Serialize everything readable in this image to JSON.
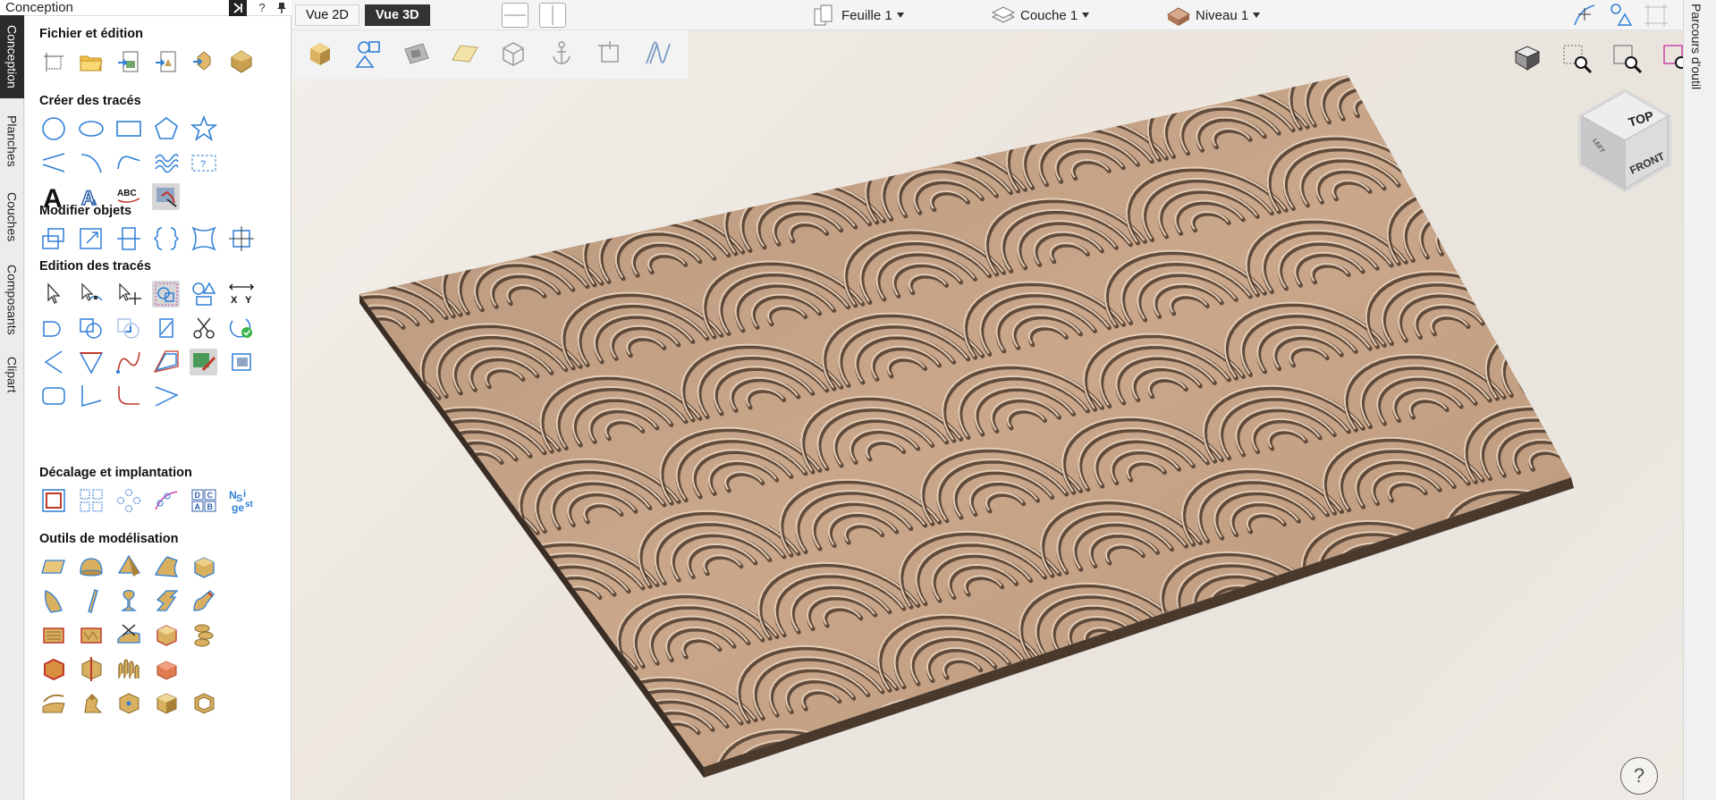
{
  "panel": {
    "title": "Conception",
    "pin_label": "?",
    "help_label": "?"
  },
  "vertical_tabs": [
    {
      "label": "Conception",
      "active": true
    },
    {
      "label": "Planches",
      "active": false
    },
    {
      "label": "Couches",
      "active": false
    },
    {
      "label": "Composants",
      "active": false
    },
    {
      "label": "Clipart",
      "active": false
    }
  ],
  "sections": {
    "fichier": "Fichier et édition",
    "creer": "Créer des tracés",
    "modifier": "Modifier objets",
    "edition": "Edition des tracés",
    "decalage": "Décalage et implantation",
    "modelisation": "Outils de modélisation"
  },
  "toolbar": {
    "vue2d": "Vue 2D",
    "vue3d": "Vue 3D",
    "feuille": "Feuille 1",
    "couche": "Couche 1",
    "niveau": "Niveau 1"
  },
  "view_cube": {
    "top": "TOP",
    "front": "FRONT",
    "left": "LEFT"
  },
  "right_tab": "Parcours d'outil",
  "help_button": "?",
  "colors": {
    "accent": "#2f7fd6",
    "wood": "#c9a88c",
    "dark": "#222222"
  }
}
